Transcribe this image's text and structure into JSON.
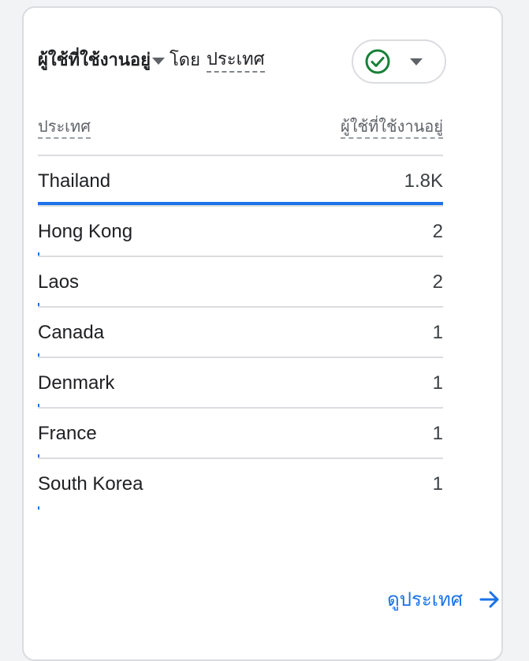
{
  "card": {
    "title_metric": "ผู้ใช้ที่ใช้งานอยู่",
    "title_by": "โดย",
    "title_dimension": "ประเทศ",
    "status_icon": "check-circle-icon",
    "status_color": "#188038"
  },
  "table": {
    "col_left": "ประเทศ",
    "col_right": "ผู้ใช้ที่ใช้งานอยู่",
    "max_value": 1800,
    "rows": [
      {
        "name": "Thailand",
        "value_label": "1.8K",
        "value": 1800
      },
      {
        "name": "Hong Kong",
        "value_label": "2",
        "value": 2
      },
      {
        "name": "Laos",
        "value_label": "2",
        "value": 2
      },
      {
        "name": "Canada",
        "value_label": "1",
        "value": 1
      },
      {
        "name": "Denmark",
        "value_label": "1",
        "value": 1
      },
      {
        "name": "France",
        "value_label": "1",
        "value": 1
      },
      {
        "name": "South Korea",
        "value_label": "1",
        "value": 1
      }
    ]
  },
  "footer": {
    "link_label": "ดูประเทศ",
    "link_icon": "arrow-right-icon"
  },
  "colors": {
    "accent": "#1a73e8",
    "divider": "#dadce0"
  }
}
